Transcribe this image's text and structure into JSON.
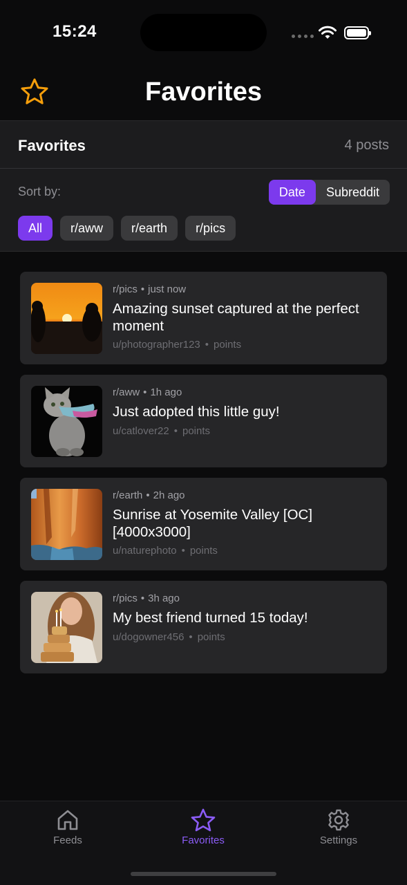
{
  "status_bar": {
    "time": "15:24"
  },
  "nav": {
    "title": "Favorites",
    "icon": "star-icon"
  },
  "panel": {
    "title": "Favorites",
    "count": "4 posts",
    "sort_label": "Sort by:",
    "sort_options": [
      "Date",
      "Subreddit"
    ],
    "sort_selected": "Date",
    "filters": [
      "All",
      "r/aww",
      "r/earth",
      "r/pics"
    ],
    "filter_selected": "All"
  },
  "posts": [
    {
      "subreddit": "r/pics",
      "time": "just now",
      "title": "Amazing sunset captured at the perfect moment",
      "author": "u/photographer123",
      "points": "points",
      "thumb": "sunset-photo"
    },
    {
      "subreddit": "r/aww",
      "time": "1h ago",
      "title": "Just adopted this little guy!",
      "author": "u/catlover22",
      "points": "points",
      "thumb": "cat-photo"
    },
    {
      "subreddit": "r/earth",
      "time": "2h ago",
      "title": "Sunrise at Yosemite Valley [OC] [4000x3000]",
      "author": "u/naturephoto",
      "points": "points",
      "thumb": "cliff-photo"
    },
    {
      "subreddit": "r/pics",
      "time": "3h ago",
      "title": "My best friend turned 15 today!",
      "author": "u/dogowner456",
      "points": "points",
      "thumb": "birthday-photo"
    }
  ],
  "tabbar": {
    "tabs": [
      {
        "label": "Feeds",
        "icon": "home-icon"
      },
      {
        "label": "Favorites",
        "icon": "star-icon"
      },
      {
        "label": "Settings",
        "icon": "gear-icon"
      }
    ],
    "active": "Favorites"
  },
  "colors": {
    "accent": "#7c3aed",
    "star_nav": "#f59e0b",
    "background": "#0b0b0c",
    "card": "#262628"
  }
}
